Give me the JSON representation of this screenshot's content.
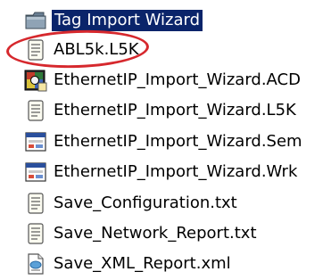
{
  "window": {
    "background": "#ffffff",
    "selection_color": "#0a246a",
    "annotation_color": "#d6282d"
  },
  "tree": {
    "folder": {
      "label": "Tag Import Wizard",
      "icon": "folder-icon",
      "selected": true
    },
    "files": [
      {
        "label": "ABL5k.L5K",
        "icon": "text-file-icon",
        "annotated": true
      },
      {
        "label": "EthernetIP_Import_Wizard.ACD",
        "icon": "rslogix-project-icon"
      },
      {
        "label": "EthernetIP_Import_Wizard.L5K",
        "icon": "text-file-icon"
      },
      {
        "label": "EthernetIP_Import_Wizard.Sem",
        "icon": "generic-file-icon"
      },
      {
        "label": "EthernetIP_Import_Wizard.Wrk",
        "icon": "generic-file-icon"
      },
      {
        "label": "Save_Configuration.txt",
        "icon": "text-file-icon"
      },
      {
        "label": "Save_Network_Report.txt",
        "icon": "text-file-icon"
      },
      {
        "label": "Save_XML_Report.xml",
        "icon": "xml-file-icon"
      }
    ]
  }
}
